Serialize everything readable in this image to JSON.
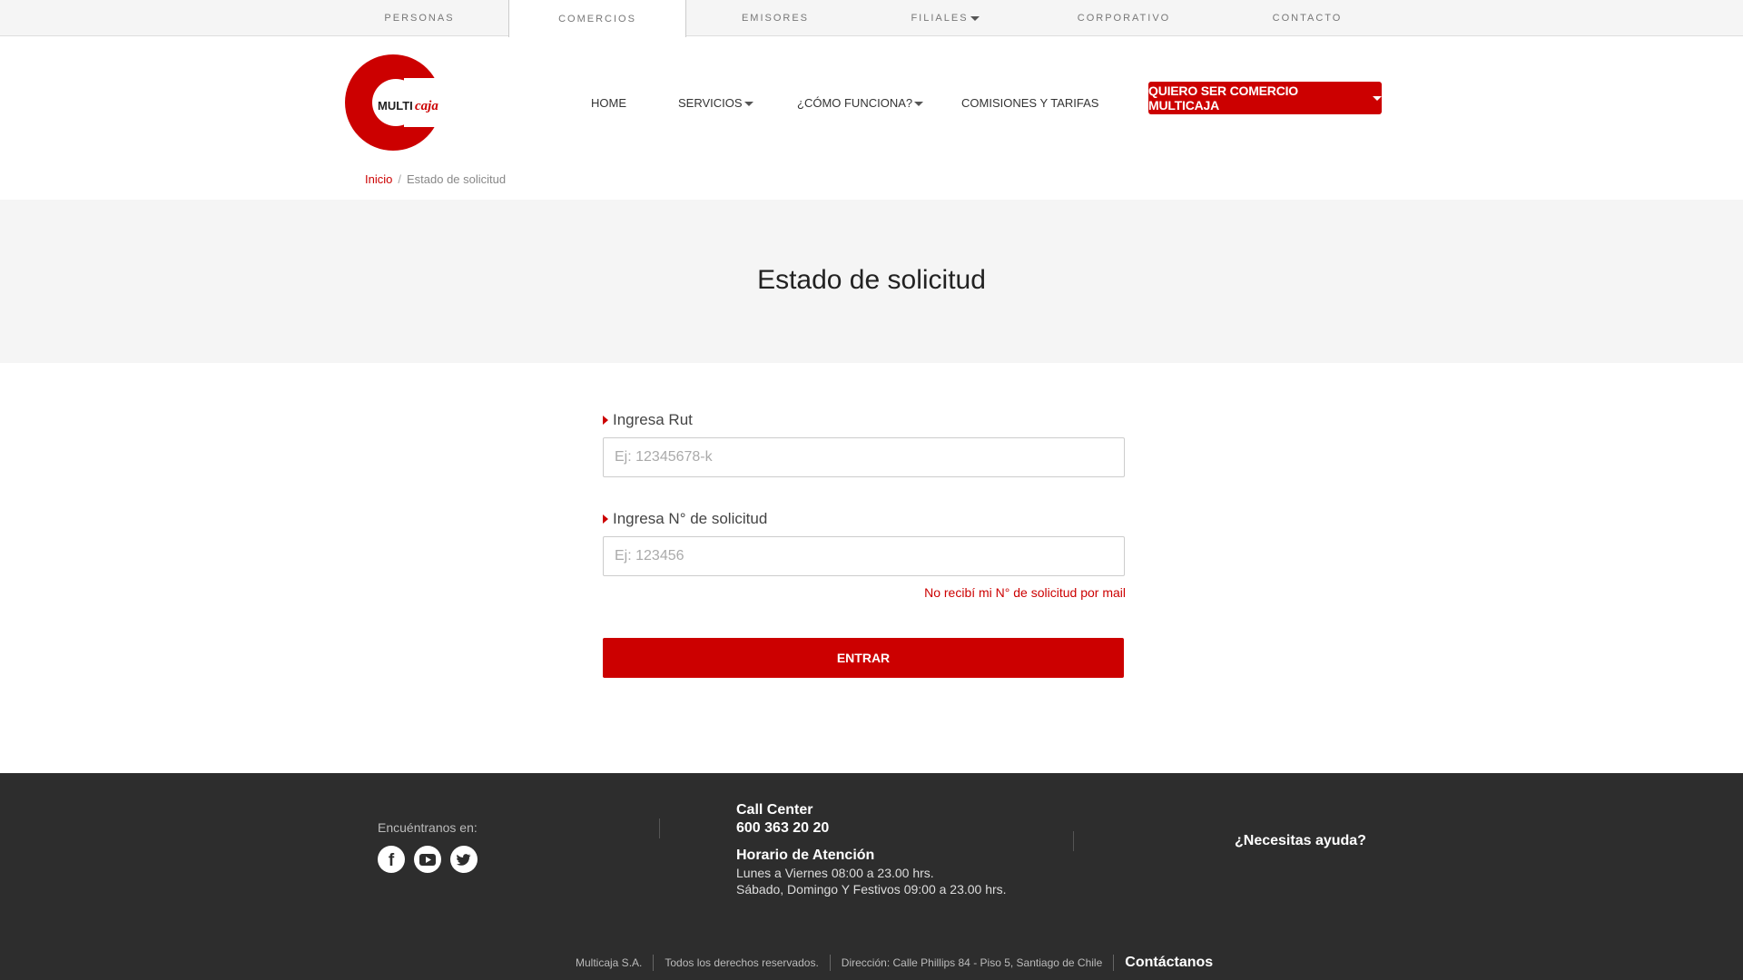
{
  "topnav": {
    "tabs": [
      {
        "label": "PERSONAS"
      },
      {
        "label": "COMERCIOS"
      },
      {
        "label": "EMISORES"
      },
      {
        "label": "FILIALES"
      },
      {
        "label": "CORPORATIVO"
      },
      {
        "label": "CONTACTO"
      }
    ]
  },
  "logo": {
    "text_bold": "MULTI",
    "text_italic": "caja",
    "color": "#cc0000"
  },
  "mainnav": {
    "items": [
      {
        "label": "HOME"
      },
      {
        "label": "SERVICIOS"
      },
      {
        "label": "¿CÓMO FUNCIONA?"
      },
      {
        "label": "COMISIONES Y TARIFAS"
      }
    ],
    "cta_label": "QUIERO SER COMERCIO MULTICAJA"
  },
  "breadcrumb": {
    "home": "Inicio",
    "separator": "/",
    "current": "Estado de solicitud"
  },
  "hero": {
    "title": "Estado de solicitud"
  },
  "form": {
    "rut_label": "Ingresa Rut",
    "rut_placeholder": "Ej: 12345678-k",
    "solicitud_label": "Ingresa N° de solicitud",
    "solicitud_placeholder": "Ej: 123456",
    "help_link": "No recibí mi N° de solicitud por mail",
    "submit_label": "ENTRAR"
  },
  "footer": {
    "find_us": "Encuéntranos en:",
    "social_icons": [
      "facebook-icon",
      "youtube-icon",
      "twitter-icon"
    ],
    "call_center_title": "Call Center",
    "call_center_number": "600 363 20 20",
    "hours_title": "Horario de Atención",
    "hours_weekdays": "Lunes a Viernes 08:00 a 23.00 hrs.",
    "hours_weekend": "Sábado, Domingo Y Festivos 09:00 a 23.00 hrs.",
    "help": "¿Necesitas ayuda?",
    "company": "Multicaja S.A.",
    "rights": "Todos los derechos reservados.",
    "address": "Dirección: Calle Phillips 84 - Piso 5, Santiago de Chile",
    "contact": "Contáctanos"
  },
  "colors": {
    "brand_red": "#cc0000",
    "footer_bg": "#2d2d2d",
    "hero_bg": "#f5f5f5"
  }
}
